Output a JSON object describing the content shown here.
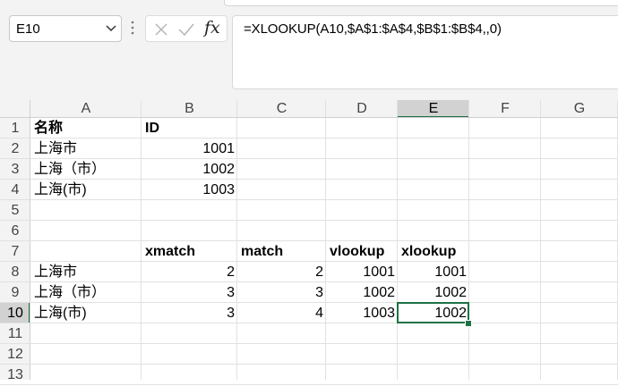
{
  "name_box": {
    "value": "E10"
  },
  "formula_bar": {
    "formula": "=XLOOKUP(A10,$A$1:$A$4,$B$1:$B$4,,0)",
    "fx_label": "fx"
  },
  "columns": [
    "A",
    "B",
    "C",
    "D",
    "E",
    "F",
    "G"
  ],
  "rows": [
    "1",
    "2",
    "3",
    "4",
    "5",
    "6",
    "7",
    "8",
    "9",
    "10",
    "11",
    "12",
    "13"
  ],
  "selected": {
    "column": "E",
    "row": "10"
  },
  "cells": {
    "A1": "名称",
    "B1": "ID",
    "A2": "上海市",
    "B2": "1001",
    "A3": "上海（市）",
    "B3": "1002",
    "A4": "上海(市)",
    "B4": "1003",
    "B7": "xmatch",
    "C7": "match",
    "D7": "vlookup",
    "E7": "xlookup",
    "A8": "上海市",
    "B8": "2",
    "C8": "2",
    "D8": "1001",
    "E8": "1001",
    "A9": "上海（市）",
    "B9": "3",
    "C9": "3",
    "D9": "1002",
    "E9": "1002",
    "A10": "上海(市)",
    "B10": "3",
    "C10": "4",
    "D10": "1003",
    "E10": "1002"
  },
  "colors": {
    "accent": "#1e7145",
    "header_selected": "#d2d2d2",
    "gridline": "#e1e1e1"
  }
}
